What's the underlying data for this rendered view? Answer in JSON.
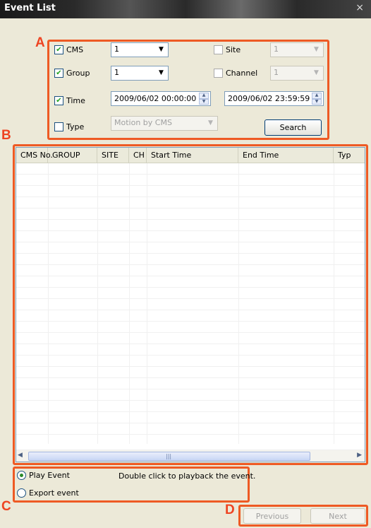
{
  "window": {
    "title": "Event List",
    "close_icon": "×"
  },
  "annotations": {
    "a": "A",
    "b": "B",
    "c": "C",
    "d": "D"
  },
  "search": {
    "cms": {
      "label": "CMS",
      "checked": true,
      "value": "1"
    },
    "group": {
      "label": "Group",
      "checked": true,
      "value": "1"
    },
    "time": {
      "label": "Time",
      "checked": true,
      "start": "2009/06/02 00:00:00",
      "end": "2009/06/02 23:59:59"
    },
    "type": {
      "label": "Type",
      "checked": false,
      "value": "Motion by CMS"
    },
    "site": {
      "label": "Site",
      "checked": false,
      "value": "1"
    },
    "channel": {
      "label": "Channel",
      "checked": false,
      "value": "1"
    },
    "search_button": "Search"
  },
  "table": {
    "columns": [
      "CMS No.",
      "GROUP",
      "SITE",
      "CH",
      "Start Time",
      "End Time",
      "Typ"
    ],
    "scroll_grip": "|||"
  },
  "options": {
    "play_event": "Play Event",
    "export_event": "Export event",
    "hint": "Double click to playback the event.",
    "selected": "play_event"
  },
  "nav": {
    "previous": "Previous",
    "next": "Next"
  },
  "colors": {
    "annotation": "#ee5a24",
    "accent": "#21a121"
  }
}
